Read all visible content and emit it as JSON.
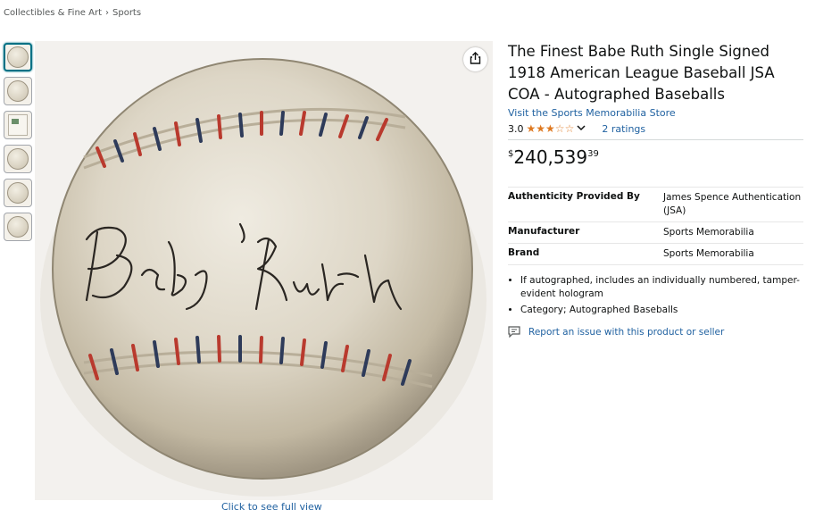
{
  "breadcrumb": {
    "items": [
      "Collectibles & Fine Art",
      "Sports"
    ],
    "separator": "›"
  },
  "thumbnails": [
    {
      "name": "baseball-front",
      "active": true
    },
    {
      "name": "baseball-side",
      "active": false
    },
    {
      "name": "certificate",
      "active": false
    },
    {
      "name": "baseball-top",
      "active": false
    },
    {
      "name": "baseball-angle",
      "active": false
    },
    {
      "name": "baseball-back",
      "active": false
    }
  ],
  "image": {
    "alt_caption": "Click to see full view",
    "share_icon": "share-icon"
  },
  "product": {
    "title": "The Finest Babe Ruth Single Signed 1918 American League Baseball JSA COA - Autographed Baseballs",
    "store_link": "Visit the Sports Memorabilia Store",
    "rating_value": "3.0",
    "rating_stars": 3,
    "ratings_count": "2 ratings",
    "price": {
      "symbol": "$",
      "whole": "240,539",
      "fraction": "39"
    }
  },
  "specs": [
    {
      "key": "Authenticity Provided By",
      "value": "James Spence Authentication (JSA)"
    },
    {
      "key": "Manufacturer",
      "value": "Sports Memorabilia"
    },
    {
      "key": "Brand",
      "value": "Sports Memorabilia"
    }
  ],
  "bullets": [
    "If autographed, includes an individually numbered, tamper-evident hologram",
    "Category; Autographed Baseballs"
  ],
  "report_link": "Report an issue with this product or seller",
  "colors": {
    "link": "#2162a1",
    "star": "#de7921",
    "accent": "#007185"
  }
}
